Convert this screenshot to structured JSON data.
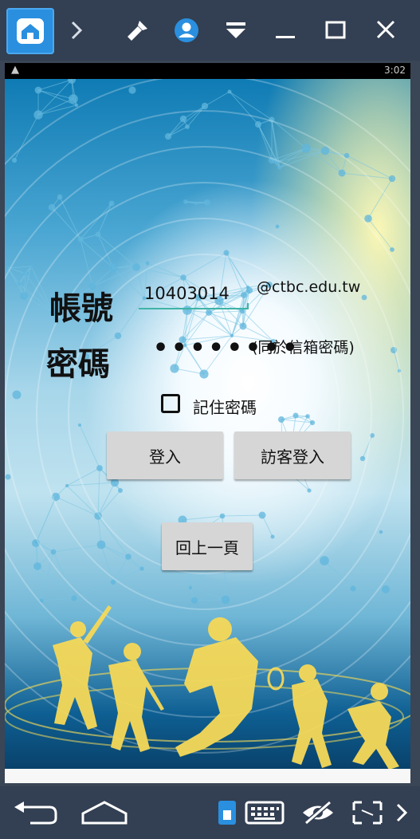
{
  "emulator": {
    "topbar": {
      "home_icon": "home-icon",
      "icons": [
        "chevron-right-icon",
        "brush-icon",
        "account-icon",
        "dropdown-icon",
        "minimize-icon",
        "maximize-icon",
        "close-icon"
      ]
    },
    "bottombar": {
      "icons": [
        "back-icon",
        "home-outline-icon",
        "phone-mode-icon",
        "keyboard-icon",
        "hide-icon",
        "fullscreen-icon",
        "chevron-right-icon"
      ]
    }
  },
  "status_bar": {
    "warning_icon": "warning-icon",
    "time": "3:02"
  },
  "login": {
    "account_label": "帳號",
    "account_value": "10403014",
    "domain_suffix": "@ctbc.edu.tw",
    "password_label": "密碼",
    "password_value": "••••••••",
    "password_note": "(同於信箱密碼)",
    "remember_label": "記住密碼",
    "remember_checked": false,
    "login_button": "登入",
    "guest_button": "訪客登入",
    "back_button": "回上一頁"
  },
  "colors": {
    "frame": "#333f52",
    "accent": "#2a8fdf",
    "button": "#d6d6d6",
    "input_underline": "#3fb4a6"
  }
}
